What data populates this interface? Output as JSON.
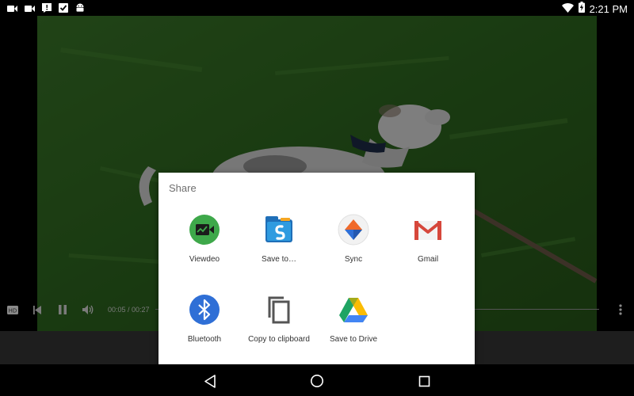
{
  "status_bar": {
    "time": "2:21 PM",
    "left_icons": [
      "video-camera-icon",
      "video-camera-icon",
      "alert-icon",
      "check-box-icon",
      "android-icon"
    ],
    "right_icons": [
      "wifi-icon",
      "battery-charging-icon"
    ]
  },
  "player": {
    "time_display": "00:05 / 00:27",
    "hd_badge": "HD"
  },
  "share_sheet": {
    "title": "Share",
    "targets": [
      {
        "label": "Viewdeo",
        "icon": "viewdeo-icon",
        "color": "#3ea84a"
      },
      {
        "label": "Save to…",
        "icon": "save-to-icon",
        "color": "#2f8fd8"
      },
      {
        "label": "Sync",
        "icon": "sync-icon",
        "color": "#f06a2a"
      },
      {
        "label": "Gmail",
        "icon": "gmail-icon",
        "color": "#d6473b"
      },
      {
        "label": "Bluetooth",
        "icon": "bluetooth-icon",
        "color": "#2f6fd6"
      },
      {
        "label": "Copy to clipboard",
        "icon": "copy-icon",
        "color": "#555555"
      },
      {
        "label": "Save to Drive",
        "icon": "google-drive-icon",
        "color": "#1fa463"
      }
    ]
  },
  "nav_bar": {
    "buttons": [
      "back-button",
      "home-button",
      "recents-button"
    ]
  }
}
